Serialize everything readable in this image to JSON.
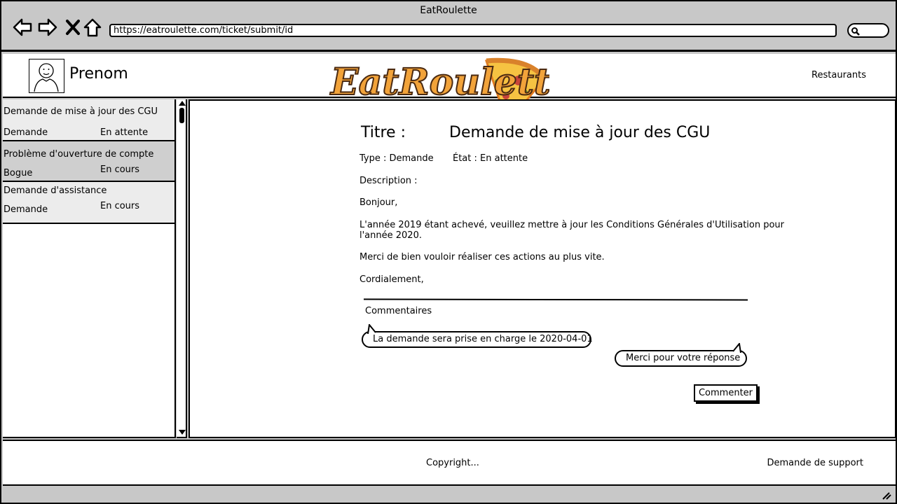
{
  "window": {
    "title": "EatRoulette"
  },
  "browser": {
    "url": "https://eatroulette.com/ticket/submit/id"
  },
  "header": {
    "username": "Prenom",
    "logo_text": "EatRoulette",
    "nav_restaurants": "Restaurants"
  },
  "tickets": [
    {
      "title": "Demande de mise à jour des CGU",
      "type": "Demande",
      "state": "En attente",
      "bg": "#ececec"
    },
    {
      "title": "Problème d'ouverture de compte",
      "type": "Bogue",
      "state": "En cours",
      "bg": "#cfcfcf"
    },
    {
      "title": "Demande d'assistance",
      "type": "Demande",
      "state": "En cours",
      "bg": "#ececec"
    }
  ],
  "detail": {
    "title_label": "Titre :",
    "title_value": "Demande de mise à jour des CGU",
    "type_line": "Type : Demande",
    "state_line": "État : En attente",
    "description_label": "Description :",
    "body": {
      "greeting": "Bonjour,",
      "line1": "L'année 2019 étant achevé, veuillez mettre à jour les Conditions Générales d'Utilisation pour",
      "line2": "l'année 2020.",
      "line3": "Merci de bien vouloir réaliser ces actions au plus vite.",
      "closing": "Cordialement,"
    },
    "comments_label": "Commentaires",
    "comments": [
      {
        "text": "La demande sera prise en charge le 2020-04-01",
        "side": "left"
      },
      {
        "text": "Merci pour votre réponse",
        "side": "right"
      }
    ],
    "comment_button": "Commenter"
  },
  "footer": {
    "copyright": "Copyright...",
    "support": "Demande de support"
  }
}
